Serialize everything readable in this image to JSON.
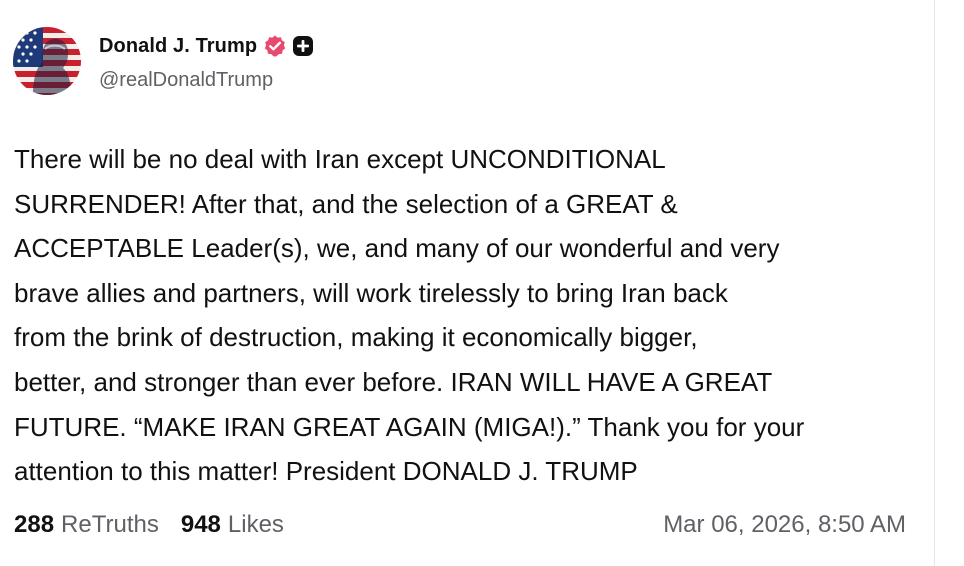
{
  "author": {
    "display_name": "Donald J. Trump",
    "handle": "@realDonaldTrump",
    "avatar_icon": "flag-portrait-avatar",
    "verified_icon": "verified-badge-icon",
    "plus_icon": "plus-badge-icon"
  },
  "post": {
    "body_lines": [
      "There will be no deal with Iran except UNCONDITIONAL",
      "SURRENDER! After that, and the selection of a GREAT &",
      "ACCEPTABLE Leader(s), we, and many of our wonderful and very",
      "brave allies and partners, will work tirelessly to bring Iran back",
      "from the brink of destruction, making it economically bigger,",
      "better, and stronger than ever before. IRAN WILL HAVE A GREAT",
      "FUTURE. “MAKE IRAN GREAT AGAIN (MIGA!).” Thank you for your",
      "attention to this matter! President DONALD J. TRUMP"
    ],
    "retruths_count": "288",
    "retruths_label": "ReTruths",
    "likes_count": "948",
    "likes_label": "Likes",
    "timestamp": "Mar 06, 2026, 8:50 AM"
  },
  "colors": {
    "verified_badge": "#e84a6f",
    "secondary_text": "#606066",
    "primary_text": "#111111"
  }
}
